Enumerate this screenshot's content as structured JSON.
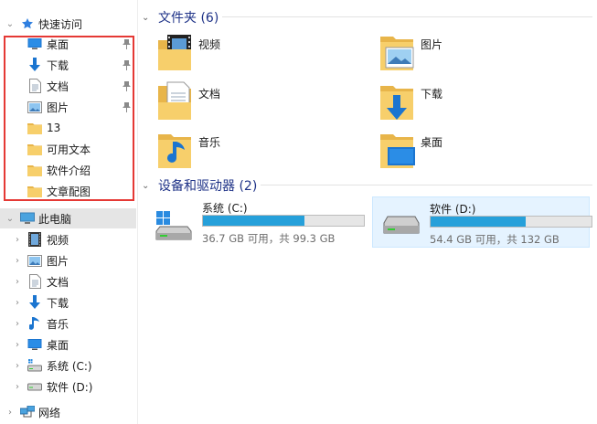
{
  "nav": {
    "quick_access": "快速访问",
    "pinned": [
      {
        "label": "桌面",
        "icon": "desktop-icon",
        "pinned": true
      },
      {
        "label": "下载",
        "icon": "download-icon",
        "pinned": true
      },
      {
        "label": "文档",
        "icon": "document-icon",
        "pinned": true
      },
      {
        "label": "图片",
        "icon": "picture-icon",
        "pinned": true
      },
      {
        "label": "13",
        "icon": "folder-icon",
        "pinned": false
      },
      {
        "label": "可用文本",
        "icon": "folder-icon",
        "pinned": false
      },
      {
        "label": "软件介绍",
        "icon": "folder-icon",
        "pinned": false
      },
      {
        "label": "文章配图",
        "icon": "folder-icon",
        "pinned": false
      }
    ],
    "this_pc": "此电脑",
    "pc_items": [
      {
        "label": "视频",
        "icon": "video-icon"
      },
      {
        "label": "图片",
        "icon": "picture-icon"
      },
      {
        "label": "文档",
        "icon": "document-icon"
      },
      {
        "label": "下载",
        "icon": "download-icon"
      },
      {
        "label": "音乐",
        "icon": "music-icon"
      },
      {
        "label": "桌面",
        "icon": "desktop-icon"
      },
      {
        "label": "系统 (C:)",
        "icon": "drive-c-icon"
      },
      {
        "label": "软件 (D:)",
        "icon": "drive-d-icon"
      }
    ],
    "network": "网络"
  },
  "main": {
    "folders_header": "文件夹 (6)",
    "folders": [
      {
        "label": "视频",
        "icon": "video-folder-icon"
      },
      {
        "label": "图片",
        "icon": "picture-folder-icon"
      },
      {
        "label": "文档",
        "icon": "document-folder-icon"
      },
      {
        "label": "下载",
        "icon": "download-folder-icon"
      },
      {
        "label": "音乐",
        "icon": "music-folder-icon"
      },
      {
        "label": "桌面",
        "icon": "desktop-folder-icon"
      }
    ],
    "drives_header": "设备和驱动器 (2)",
    "drives": [
      {
        "name": "系统 (C:)",
        "space": "36.7 GB 可用，共 99.3 GB",
        "used_fraction": 0.63,
        "selected": false
      },
      {
        "name": "软件 (D:)",
        "space": "54.4 GB 可用，共 132 GB",
        "used_fraction": 0.59,
        "selected": true
      }
    ]
  },
  "colors": {
    "accent": "#26a0da",
    "section_title": "#1e3287",
    "highlight_box": "#e53935",
    "folder": "#f5c85f"
  }
}
